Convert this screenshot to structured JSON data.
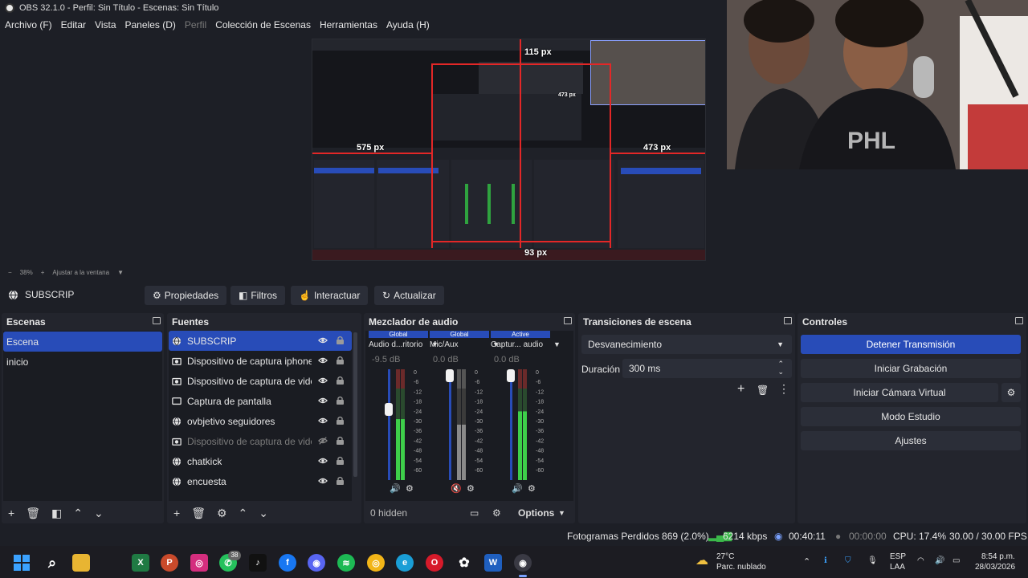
{
  "window": {
    "title": "OBS 32.1.0 - Perfil: Sin Título - Escenas: Sin Título"
  },
  "menu": [
    {
      "label": "Archivo (F)",
      "disabled": false
    },
    {
      "label": "Editar",
      "disabled": false
    },
    {
      "label": "Vista",
      "disabled": false
    },
    {
      "label": "Paneles (D)",
      "disabled": false
    },
    {
      "label": "Perfil",
      "disabled": true
    },
    {
      "label": "Colección de Escenas",
      "disabled": false
    },
    {
      "label": "Herramientas",
      "disabled": false
    },
    {
      "label": "Ayuda (H)",
      "disabled": false
    }
  ],
  "preview": {
    "labels": {
      "top": "115 px",
      "left": "575 px",
      "right": "473 px",
      "bottom": "93 px"
    },
    "inner_labels": {
      "small_top": "473 px"
    }
  },
  "zoom": {
    "minus": "−",
    "level": "38%",
    "plus": "+",
    "fit": "Ajustar a la ventana"
  },
  "source_toolbar": {
    "name": "SUBSCRIP",
    "properties": "Propiedades",
    "filters": "Filtros",
    "interact": "Interactuar",
    "refresh": "Actualizar"
  },
  "scenes": {
    "title": "Escenas",
    "items": [
      {
        "label": "Escena",
        "selected": true
      },
      {
        "label": "inicio",
        "selected": false
      }
    ]
  },
  "sources": {
    "title": "Fuentes",
    "items": [
      {
        "label": "SUBSCRIP",
        "icon": "globe-icon",
        "selected": true,
        "hidden": false
      },
      {
        "label": "Dispositivo de captura iphone",
        "icon": "camera-icon",
        "selected": false,
        "hidden": false
      },
      {
        "label": "Dispositivo de captura de video",
        "icon": "camera-icon",
        "selected": false,
        "hidden": false
      },
      {
        "label": "Captura de pantalla",
        "icon": "monitor-icon",
        "selected": false,
        "hidden": false
      },
      {
        "label": "ovbjetivo seguidores",
        "icon": "globe-icon",
        "selected": false,
        "hidden": false
      },
      {
        "label": "Dispositivo de captura de video",
        "icon": "camera-icon",
        "selected": false,
        "hidden": true
      },
      {
        "label": "chatkick",
        "icon": "globe-icon",
        "selected": false,
        "hidden": false
      },
      {
        "label": "encuesta",
        "icon": "globe-icon",
        "selected": false,
        "hidden": false
      }
    ]
  },
  "mixer": {
    "title": "Mezclador de audio",
    "channels": [
      {
        "tag": "Global",
        "tag_color": "#284cb8",
        "name": "Audio d...ritorio",
        "db": "-9.5 dB",
        "muted": false
      },
      {
        "tag": "Global",
        "tag_color": "#284cb8",
        "name": "Mic/Aux",
        "db": "0.0 dB",
        "muted": true
      },
      {
        "tag": "Active",
        "tag_color": "#284cb8",
        "name": "Captur... audio",
        "db": "0.0 dB",
        "muted": false
      }
    ],
    "scale": [
      "0",
      "-6",
      "-12",
      "-18",
      "-24",
      "-30",
      "-36",
      "-42",
      "-48",
      "-54",
      "-60"
    ],
    "hidden": "0 hidden",
    "options": "Options"
  },
  "transitions": {
    "title": "Transiciones de escena",
    "type": "Desvanecimiento",
    "duration_label": "Duración",
    "duration_value": "300 ms"
  },
  "controls": {
    "title": "Controles",
    "buttons": [
      {
        "label": "Detener Transmisión",
        "primary": true
      },
      {
        "label": "Iniciar Grabación",
        "primary": false
      },
      {
        "label": "Iniciar Cámara Virtual",
        "primary": false
      },
      {
        "label": "Modo Estudio",
        "primary": false
      },
      {
        "label": "Ajustes",
        "primary": false
      }
    ]
  },
  "status": {
    "dropped": "Fotogramas Perdidos 869 (2.0%)",
    "bitrate": "6214 kbps",
    "stream_time": "00:40:11",
    "rec_time": "00:00:00",
    "cpu": "CPU: 17.4%",
    "fps": "30.00 / 30.00 FPS"
  },
  "taskbar": {
    "weather_temp": "27°C",
    "weather_desc": "Parc. nublado",
    "lang": "ESP",
    "lang_sub": "LAA",
    "time": "8:54 p.m.",
    "date": "28/03/2026",
    "whatsapp_badge": "38",
    "apps": [
      "windows",
      "search",
      "files",
      "excel",
      "powerpoint",
      "instagram",
      "whatsapp",
      "tiktok",
      "facebook",
      "discord",
      "spotify",
      "chrome",
      "edge",
      "opera",
      "chatgpt",
      "word",
      "obs"
    ]
  },
  "colors": {
    "accent": "#284cb8",
    "panel": "#23252d",
    "bg": "#1d1f26",
    "red": "#e32727"
  }
}
